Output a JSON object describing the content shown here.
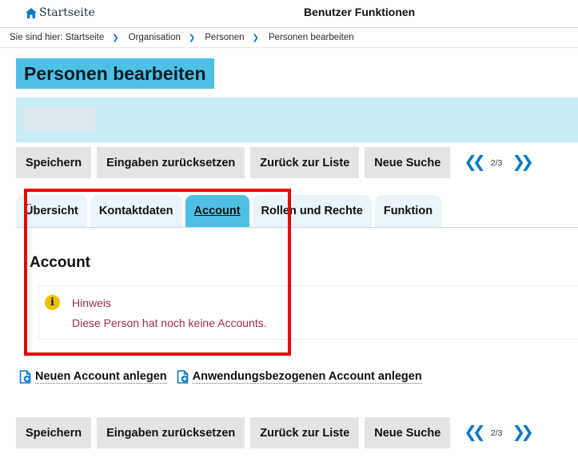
{
  "topbar": {
    "home_label": "Startseite",
    "menu_title": "Benutzer Funktionen"
  },
  "breadcrumb": {
    "prefix": "Sie sind hier:",
    "items": [
      "Startseite",
      "Organisation",
      "Personen",
      "Personen bearbeiten"
    ]
  },
  "page_title": "Personen bearbeiten",
  "toolbar": {
    "save": "Speichern",
    "reset": "Eingaben zurücksetzen",
    "back": "Zurück zur Liste",
    "new_search": "Neue Suche",
    "pager": "2/3"
  },
  "tabs": [
    {
      "label": "Übersicht",
      "active": false
    },
    {
      "label": "Kontaktdaten",
      "active": false
    },
    {
      "label": "Account",
      "active": true
    },
    {
      "label": "Rollen und Rechte",
      "active": false
    },
    {
      "label": "Funktion",
      "active": false
    }
  ],
  "section": {
    "heading": "Account",
    "hint_title": "Hinweis",
    "hint_text": "Diese Person hat noch keine Accounts."
  },
  "actions": {
    "new_account": "Neuen Account anlegen",
    "app_account": "Anwendungsbezogenen Account anlegen"
  },
  "colors": {
    "accent": "#4fc0e5",
    "band": "#c8ebf5",
    "link_blue": "#0a7ac4",
    "hint_text": "#9b2d4a",
    "highlight": "#ee0000"
  }
}
